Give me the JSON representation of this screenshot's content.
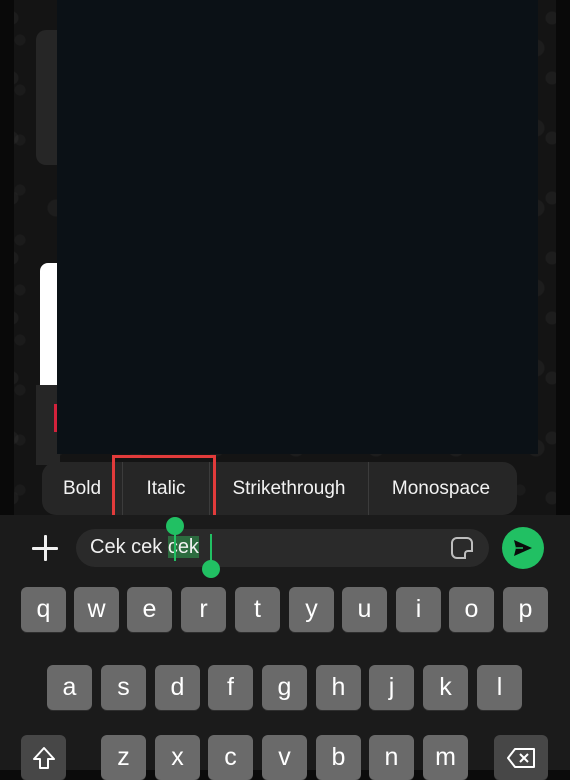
{
  "format_menu": {
    "items": [
      "Bold",
      "Italic",
      "Strikethrough",
      "Monospace"
    ]
  },
  "composer": {
    "text_before": "Cek cek ",
    "text_selected": "cek"
  },
  "icons": {
    "attach": "plus-icon",
    "sticker": "sticker-icon",
    "send": "send-icon",
    "shift": "shift-icon",
    "backspace": "backspace-icon"
  },
  "keyboard": {
    "row1": [
      "q",
      "w",
      "e",
      "r",
      "t",
      "y",
      "u",
      "i",
      "o",
      "p"
    ],
    "row2": [
      "a",
      "s",
      "d",
      "f",
      "g",
      "h",
      "j",
      "k",
      "l"
    ],
    "row3": [
      "z",
      "x",
      "c",
      "v",
      "b",
      "n",
      "m"
    ]
  },
  "colors": {
    "accent": "#21c063",
    "highlight_border": "#e23b3b",
    "selection": "#2c6b3f"
  }
}
